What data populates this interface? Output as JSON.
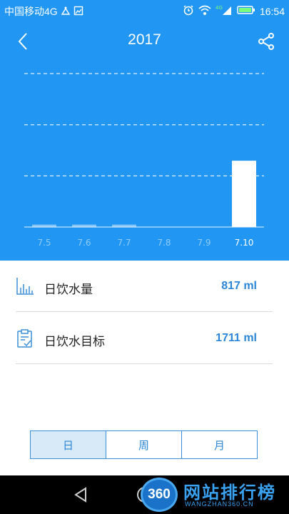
{
  "status_bar": {
    "carrier": "中国移动4G",
    "time": "16:54",
    "network_badge": "4G",
    "colors": {
      "bg": "#2196f3"
    }
  },
  "header": {
    "title": "2017",
    "back_icon": "chevron-left-icon",
    "share_icon": "share-icon"
  },
  "chart_data": {
    "type": "bar",
    "categories": [
      "7.5",
      "7.6",
      "7.7",
      "7.8",
      "7.9",
      "7.10"
    ],
    "values": [
      30,
      30,
      30,
      0,
      0,
      817
    ],
    "highlight_index": 5,
    "ylim": [
      0,
      1900
    ],
    "gridlines": [
      630,
      1260,
      1890
    ],
    "grid": true,
    "title": "",
    "xlabel": "",
    "ylabel": ""
  },
  "stats": {
    "daily_intake": {
      "label": "日饮水量",
      "value": "817 ml",
      "icon": "bar-chart-icon"
    },
    "daily_goal": {
      "label": "日饮水目标",
      "value": "1711 ml",
      "icon": "clipboard-check-icon"
    }
  },
  "tabs": [
    {
      "label": "日",
      "active": true
    },
    {
      "label": "周",
      "active": false
    },
    {
      "label": "月",
      "active": false
    }
  ],
  "watermark": {
    "badge": "360",
    "title": "网站排行榜",
    "url": "WANGZHAN360.CN"
  },
  "colors": {
    "accent": "#2196f3",
    "value_text": "#2b86d6"
  }
}
